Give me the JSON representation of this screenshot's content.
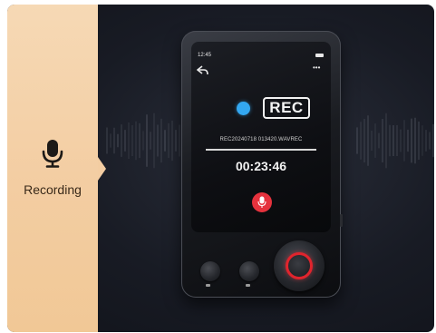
{
  "panel": {
    "icon": "microphone-icon",
    "label": "Recording",
    "colors": {
      "panel": "#f3cda2",
      "text": "#3a2a1a"
    }
  },
  "device": {
    "status_bar": {
      "time": "12:45"
    },
    "screen": {
      "rec_badge": "REC",
      "filename": "REC20240718 013420.WAVREC",
      "elapsed": "00:23:46",
      "colors": {
        "rec_dot": "#33a7f0",
        "mic_button": "#e5323d",
        "dial_ring": "#e0242d"
      }
    },
    "icons": [
      "back-arrow-icon",
      "more-dots-icon",
      "battery-icon",
      "microphone-icon"
    ]
  }
}
